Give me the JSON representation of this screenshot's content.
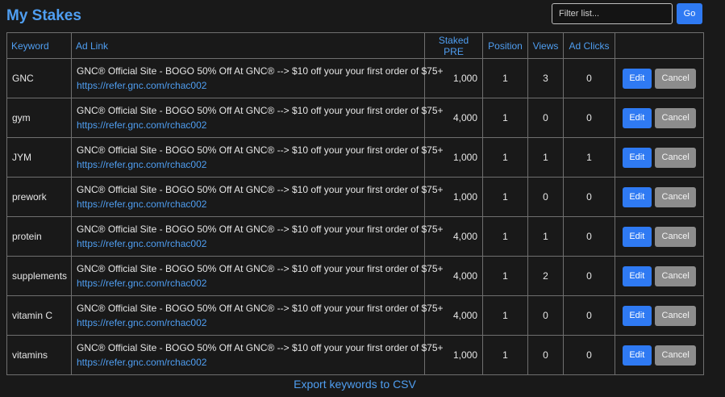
{
  "header": {
    "title": "My Stakes",
    "filter_placeholder": "Filter list...",
    "filter_value": "",
    "go_label": "Go"
  },
  "table": {
    "columns": [
      "Keyword",
      "Ad Link",
      "Staked PRE",
      "Position",
      "Views",
      "Ad Clicks",
      ""
    ],
    "edit_label": "Edit",
    "cancel_label": "Cancel",
    "rows": [
      {
        "keyword": "GNC",
        "ad_text": "GNC® Official Site - BOGO 50% Off At GNC® --> $10 off your your first order of $75+",
        "ad_url": "https://refer.gnc.com/rchac002",
        "staked": "1,000",
        "position": "1",
        "views": "3",
        "clicks": "0"
      },
      {
        "keyword": "gym",
        "ad_text": "GNC® Official Site - BOGO 50% Off At GNC® --> $10 off your your first order of $75+",
        "ad_url": "https://refer.gnc.com/rchac002",
        "staked": "4,000",
        "position": "1",
        "views": "0",
        "clicks": "0"
      },
      {
        "keyword": "JYM",
        "ad_text": "GNC® Official Site - BOGO 50% Off At GNC® --> $10 off your your first order of $75+",
        "ad_url": "https://refer.gnc.com/rchac002",
        "staked": "1,000",
        "position": "1",
        "views": "1",
        "clicks": "1"
      },
      {
        "keyword": "prework",
        "ad_text": "GNC® Official Site - BOGO 50% Off At GNC® --> $10 off your your first order of $75+",
        "ad_url": "https://refer.gnc.com/rchac002",
        "staked": "1,000",
        "position": "1",
        "views": "0",
        "clicks": "0"
      },
      {
        "keyword": "protein",
        "ad_text": "GNC® Official Site - BOGO 50% Off At GNC® --> $10 off your your first order of $75+",
        "ad_url": "https://refer.gnc.com/rchac002",
        "staked": "4,000",
        "position": "1",
        "views": "1",
        "clicks": "0"
      },
      {
        "keyword": "supplements",
        "ad_text": "GNC® Official Site - BOGO 50% Off At GNC® --> $10 off your your first order of $75+",
        "ad_url": "https://refer.gnc.com/rchac002",
        "staked": "4,000",
        "position": "1",
        "views": "2",
        "clicks": "0"
      },
      {
        "keyword": "vitamin C",
        "ad_text": "GNC® Official Site - BOGO 50% Off At GNC® --> $10 off your your first order of $75+",
        "ad_url": "https://refer.gnc.com/rchac002",
        "staked": "4,000",
        "position": "1",
        "views": "0",
        "clicks": "0"
      },
      {
        "keyword": "vitamins",
        "ad_text": "GNC® Official Site - BOGO 50% Off At GNC® --> $10 off your your first order of $75+",
        "ad_url": "https://refer.gnc.com/rchac002",
        "staked": "1,000",
        "position": "1",
        "views": "0",
        "clicks": "0"
      }
    ]
  },
  "footer": {
    "export_label": "Export keywords to CSV"
  },
  "colors": {
    "background": "#191919",
    "accent": "#4f9ef1",
    "primary_button": "#2f7af3",
    "secondary_button": "#8c8c8c",
    "border": "#6f6f6f"
  }
}
